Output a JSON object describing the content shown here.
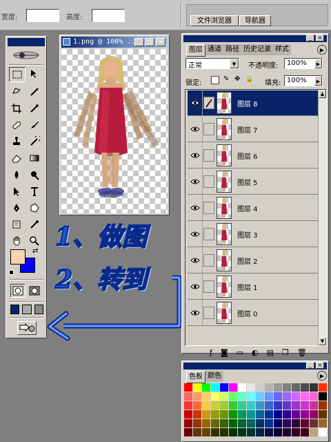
{
  "options_bar": {
    "width_label": "宽度:",
    "height_label": "高度:",
    "tabs": [
      "文件浏览器",
      "导航器"
    ]
  },
  "document": {
    "title": "1.png @ 100% ..."
  },
  "layers_panel": {
    "tabs": [
      "图层",
      "通道",
      "路径",
      "历史记录",
      "样式"
    ],
    "blend_mode": "正常",
    "opacity_label": "不透明度:",
    "opacity_value": "100%",
    "lock_label": "锁定:",
    "fill_label": "填充:",
    "fill_value": "100%",
    "layers": [
      {
        "name": "图层 8",
        "selected": true
      },
      {
        "name": "图层 7",
        "selected": false
      },
      {
        "name": "图层 6",
        "selected": false
      },
      {
        "name": "图层 5",
        "selected": false
      },
      {
        "name": "图层 4",
        "selected": false
      },
      {
        "name": "图层 3",
        "selected": false
      },
      {
        "name": "图层 2",
        "selected": false
      },
      {
        "name": "图层 1",
        "selected": false
      },
      {
        "name": "图层 0",
        "selected": false
      }
    ]
  },
  "swatches_panel": {
    "tabs": [
      "色板",
      "颜色"
    ]
  },
  "annotation": {
    "line1": "1、做图",
    "line2": "2、转到"
  },
  "colors": {
    "foreground": "#f9d3ae",
    "background": "#0000ff",
    "selection": "#0a246a",
    "annotation": "#1a53d6"
  }
}
